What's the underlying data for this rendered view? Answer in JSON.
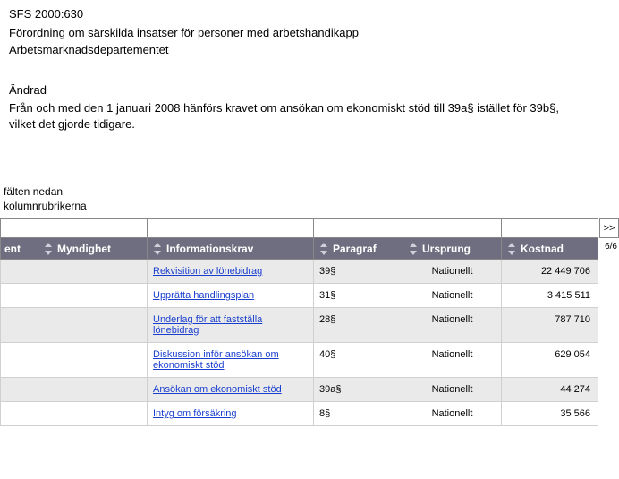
{
  "header": {
    "sfs_title": "SFS 2000:630",
    "sfs_description": "Förordning om särskilda insatser för personer med arbetshandikapp",
    "department": "Arbetsmarknadsdepartementet",
    "changed_label": "Ändrad",
    "changed_text": "Från och med den 1 januari 2008 hänförs kravet om ansökan om ekonomiskt stöd till 39a§ istället för 39b§, vilket det gjorde tidigare."
  },
  "filter_hint_line1": "fälten nedan",
  "filter_hint_line2": "kolumnrubrikerna",
  "columns": {
    "c1": "ent",
    "c2": "Myndighet",
    "c3": "Informationskrav",
    "c4": "Paragraf",
    "c5": "Ursprung",
    "c6": "Kostnad"
  },
  "next_label": ">>",
  "page_count": "6/6",
  "rows": [
    {
      "info": "Rekvisition av lönebidrag",
      "para": "39§",
      "origin": "Nationellt",
      "cost": "22 449 706",
      "alt": true
    },
    {
      "info": "Upprätta handlingsplan",
      "para": "31§",
      "origin": "Nationellt",
      "cost": "3 415 511",
      "alt": false
    },
    {
      "info": "Underlag för att fastställa lönebidrag",
      "para": "28§",
      "origin": "Nationellt",
      "cost": "787 710",
      "alt": true
    },
    {
      "info": "Diskussion inför ansökan om ekonomiskt stöd",
      "para": "40§",
      "origin": "Nationellt",
      "cost": "629 054",
      "alt": false
    },
    {
      "info": "Ansökan om ekonomiskt stöd",
      "para": "39a§",
      "origin": "Nationellt",
      "cost": "44 274",
      "alt": true
    },
    {
      "info": "Intyg om försäkring",
      "para": "8§",
      "origin": "Nationellt",
      "cost": "35 566",
      "alt": false
    }
  ]
}
